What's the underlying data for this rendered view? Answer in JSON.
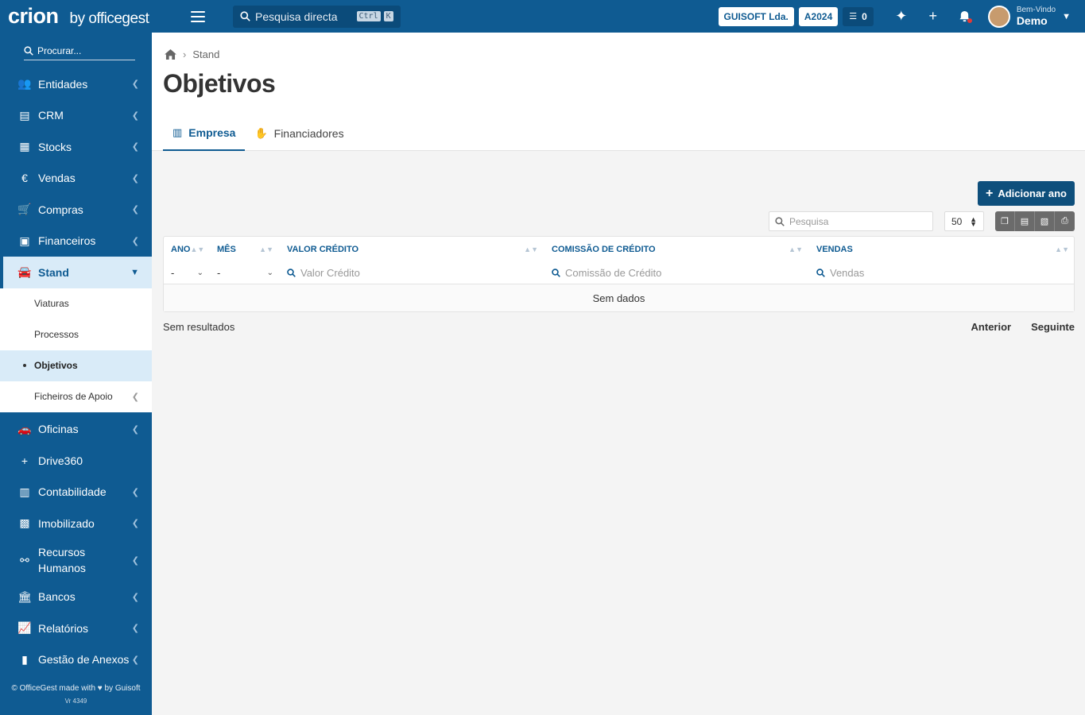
{
  "brand": {
    "logo": "crion",
    "by": "by officegest"
  },
  "top_search": {
    "placeholder": "Pesquisa directa",
    "kbd1": "Ctrl",
    "kbd2": "K"
  },
  "top": {
    "company": "GUISOFT Lda.",
    "year": "A2024",
    "tasks_count": "0",
    "welcome": "Bem-Vindo",
    "user_name": "Demo"
  },
  "sidebar": {
    "search_placeholder": "Procurar...",
    "items": [
      {
        "label": "Entidades",
        "icon": "users-icon"
      },
      {
        "label": "CRM",
        "icon": "crm-icon"
      },
      {
        "label": "Stocks",
        "icon": "stocks-icon"
      },
      {
        "label": "Vendas",
        "icon": "euro-icon"
      },
      {
        "label": "Compras",
        "icon": "cart-icon"
      },
      {
        "label": "Financeiros",
        "icon": "money-icon"
      },
      {
        "label": "Stand",
        "icon": "car-icon"
      }
    ],
    "sub_items": [
      {
        "label": "Viaturas"
      },
      {
        "label": "Processos"
      },
      {
        "label": "Objetivos"
      },
      {
        "label": "Ficheiros de Apoio"
      }
    ],
    "items_after": [
      {
        "label": "Oficinas",
        "icon": "car-front-icon"
      },
      {
        "label": "Drive360",
        "icon": "plus-icon"
      },
      {
        "label": "Contabilidade",
        "icon": "calculator-icon"
      },
      {
        "label": "Imobilizado",
        "icon": "boxes-icon"
      },
      {
        "label": "Recursos Humanos",
        "icon": "org-chart-icon"
      },
      {
        "label": "Bancos",
        "icon": "bank-icon"
      },
      {
        "label": "Relatórios",
        "icon": "chart-icon"
      },
      {
        "label": "Gestão de Anexos",
        "icon": "file-icon"
      }
    ],
    "footer": "© OfficeGest made with ♥ by Guisoft",
    "version": "Vr 4349"
  },
  "breadcrumb": {
    "current": "Stand"
  },
  "page": {
    "title": "Objetivos"
  },
  "tabs": [
    {
      "label": "Empresa"
    },
    {
      "label": "Financiadores"
    }
  ],
  "actions": {
    "add_label": "Adicionar ano"
  },
  "table": {
    "search_placeholder": "Pesquisa",
    "page_size": "50",
    "columns": [
      "ANO",
      "MÊS",
      "VALOR CRÉDITO",
      "COMISSÃO DE CRÉDITO",
      "VENDAS"
    ],
    "filters": {
      "ano": "-",
      "mes": "-",
      "valor_credito": "Valor Crédito",
      "comissao": "Comissão de Crédito",
      "vendas": "Vendas"
    },
    "empty": "Sem dados",
    "results": "Sem resultados",
    "prev": "Anterior",
    "next": "Seguinte"
  }
}
